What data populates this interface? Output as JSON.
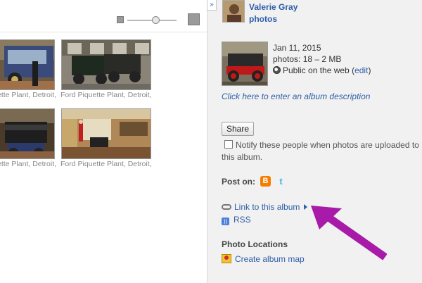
{
  "toolbar": {
    "collapse_label": "»"
  },
  "photos": [
    {
      "caption": "ette Plant, Detroit,"
    },
    {
      "caption": "Ford Piquette Plant, Detroit,"
    },
    {
      "caption": "ette Plant, Detroit,"
    },
    {
      "caption": "Ford Piquette Plant, Detroit,"
    }
  ],
  "owner": {
    "name": "Valerie Gray",
    "link": "photos"
  },
  "album": {
    "date": "Jan 11, 2015",
    "stats": "photos: 18 – 2 MB",
    "visibility": "Public on the web",
    "edit_open": "(",
    "edit_label": "edit",
    "edit_close": ")",
    "description_prompt": "Click here to enter an album description"
  },
  "share": {
    "button_label": "Share",
    "notify_text": "Notify these people when photos are uploaded to this album."
  },
  "post_on": {
    "label": "Post on:",
    "blogger_icon": "blogger-icon",
    "twitter_icon": "twitter-icon"
  },
  "links": {
    "link_album": "Link to this album",
    "rss": "RSS"
  },
  "locations": {
    "heading": "Photo Locations",
    "map_link": "Create album map"
  },
  "colors": {
    "link": "#2f5ea8",
    "sidebar_bg": "#f1f1f1",
    "arrow": "#a81aa8"
  }
}
